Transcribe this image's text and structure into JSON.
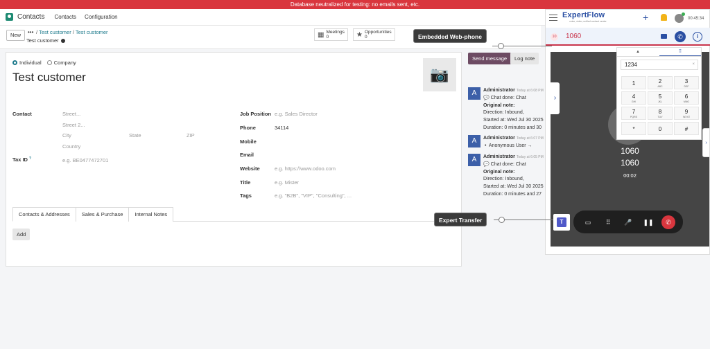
{
  "banner": "Database neutralized for testing: no emails sent, etc.",
  "topnav": {
    "app_name": "Contacts",
    "menu": [
      "Contacts",
      "Configuration"
    ]
  },
  "control": {
    "new_label": "New",
    "more": "•••",
    "breadcrumb": [
      "Test customer",
      "Test customer"
    ],
    "record_name": "Test customer",
    "smart_buttons": [
      {
        "label": "Meetings",
        "count": "0",
        "icon": "calendar-icon"
      },
      {
        "label": "Opportunities",
        "count": "0",
        "icon": "star-icon"
      }
    ]
  },
  "form": {
    "type_options": [
      "Individual",
      "Company"
    ],
    "selected_type": "Individual",
    "title": "Test customer",
    "contact_label": "Contact",
    "street_ph": "Street...",
    "street2_ph": "Street 2...",
    "city_ph": "City",
    "state_ph": "State",
    "zip_ph": "ZIP",
    "country_ph": "Country",
    "taxid_label": "Tax ID",
    "taxid_help": "?",
    "taxid_ph": "e.g. BE0477472701",
    "right_fields": [
      {
        "label": "Job Position",
        "value": "",
        "placeholder": "e.g. Sales Director"
      },
      {
        "label": "Phone",
        "value": "34114",
        "placeholder": ""
      },
      {
        "label": "Mobile",
        "value": "",
        "placeholder": ""
      },
      {
        "label": "Email",
        "value": "",
        "placeholder": ""
      },
      {
        "label": "Website",
        "value": "",
        "placeholder": "e.g. https://www.odoo.com"
      },
      {
        "label": "Title",
        "value": "",
        "placeholder": "e.g. Mister"
      },
      {
        "label": "Tags",
        "value": "",
        "placeholder": "e.g. \"B2B\", \"VIP\", \"Consulting\", ..."
      }
    ],
    "tabs": [
      "Contacts & Addresses",
      "Sales & Purchase",
      "Internal Notes"
    ],
    "add_label": "Add"
  },
  "chatter": {
    "send_message": "Send message",
    "log_note": "Log note",
    "messages": [
      {
        "author": "Administrator",
        "time": "Today at 6:08 PM",
        "lines": [
          "Chat done: Chat",
          "Original note:",
          "Direction: Inbound,",
          "Started at: Wed Jul 30 2025",
          "Duration: 0 minutes and 30"
        ]
      },
      {
        "author": "Administrator",
        "time": "Today at 6:07 PM",
        "lines": [
          "Anonymous User →"
        ]
      },
      {
        "author": "Administrator",
        "time": "Today at 6:05 PM",
        "lines": [
          "Chat done: Chat",
          "Original note:",
          "Direction: Inbound,",
          "Started at: Wed Jul 30 2025",
          "Duration: 0 minutes and 27"
        ]
      }
    ]
  },
  "callouts": {
    "webphone": "Embedded Web-phone",
    "transfer": "Expert Transfer"
  },
  "phone": {
    "brand": "ExpertFlow",
    "tagline": "voice, video, unified contact center",
    "time": "00:45:34",
    "badge": "10",
    "call_number": "1060",
    "video_number_1": "1060",
    "video_number_2": "1060",
    "video_timer": "00:02",
    "dial_input": "1234",
    "clear": "×",
    "keys": [
      {
        "digit": "1",
        "letters": ""
      },
      {
        "digit": "2",
        "letters": "ABC"
      },
      {
        "digit": "3",
        "letters": "DEF"
      },
      {
        "digit": "4",
        "letters": "GHI"
      },
      {
        "digit": "5",
        "letters": "JKL"
      },
      {
        "digit": "6",
        "letters": "MNO"
      },
      {
        "digit": "7",
        "letters": "PQRS"
      },
      {
        "digit": "8",
        "letters": "TUV"
      },
      {
        "digit": "9",
        "letters": "WXYZ"
      },
      {
        "digit": "*",
        "letters": ""
      },
      {
        "digit": "0",
        "letters": ""
      },
      {
        "digit": "#",
        "letters": ""
      }
    ]
  }
}
